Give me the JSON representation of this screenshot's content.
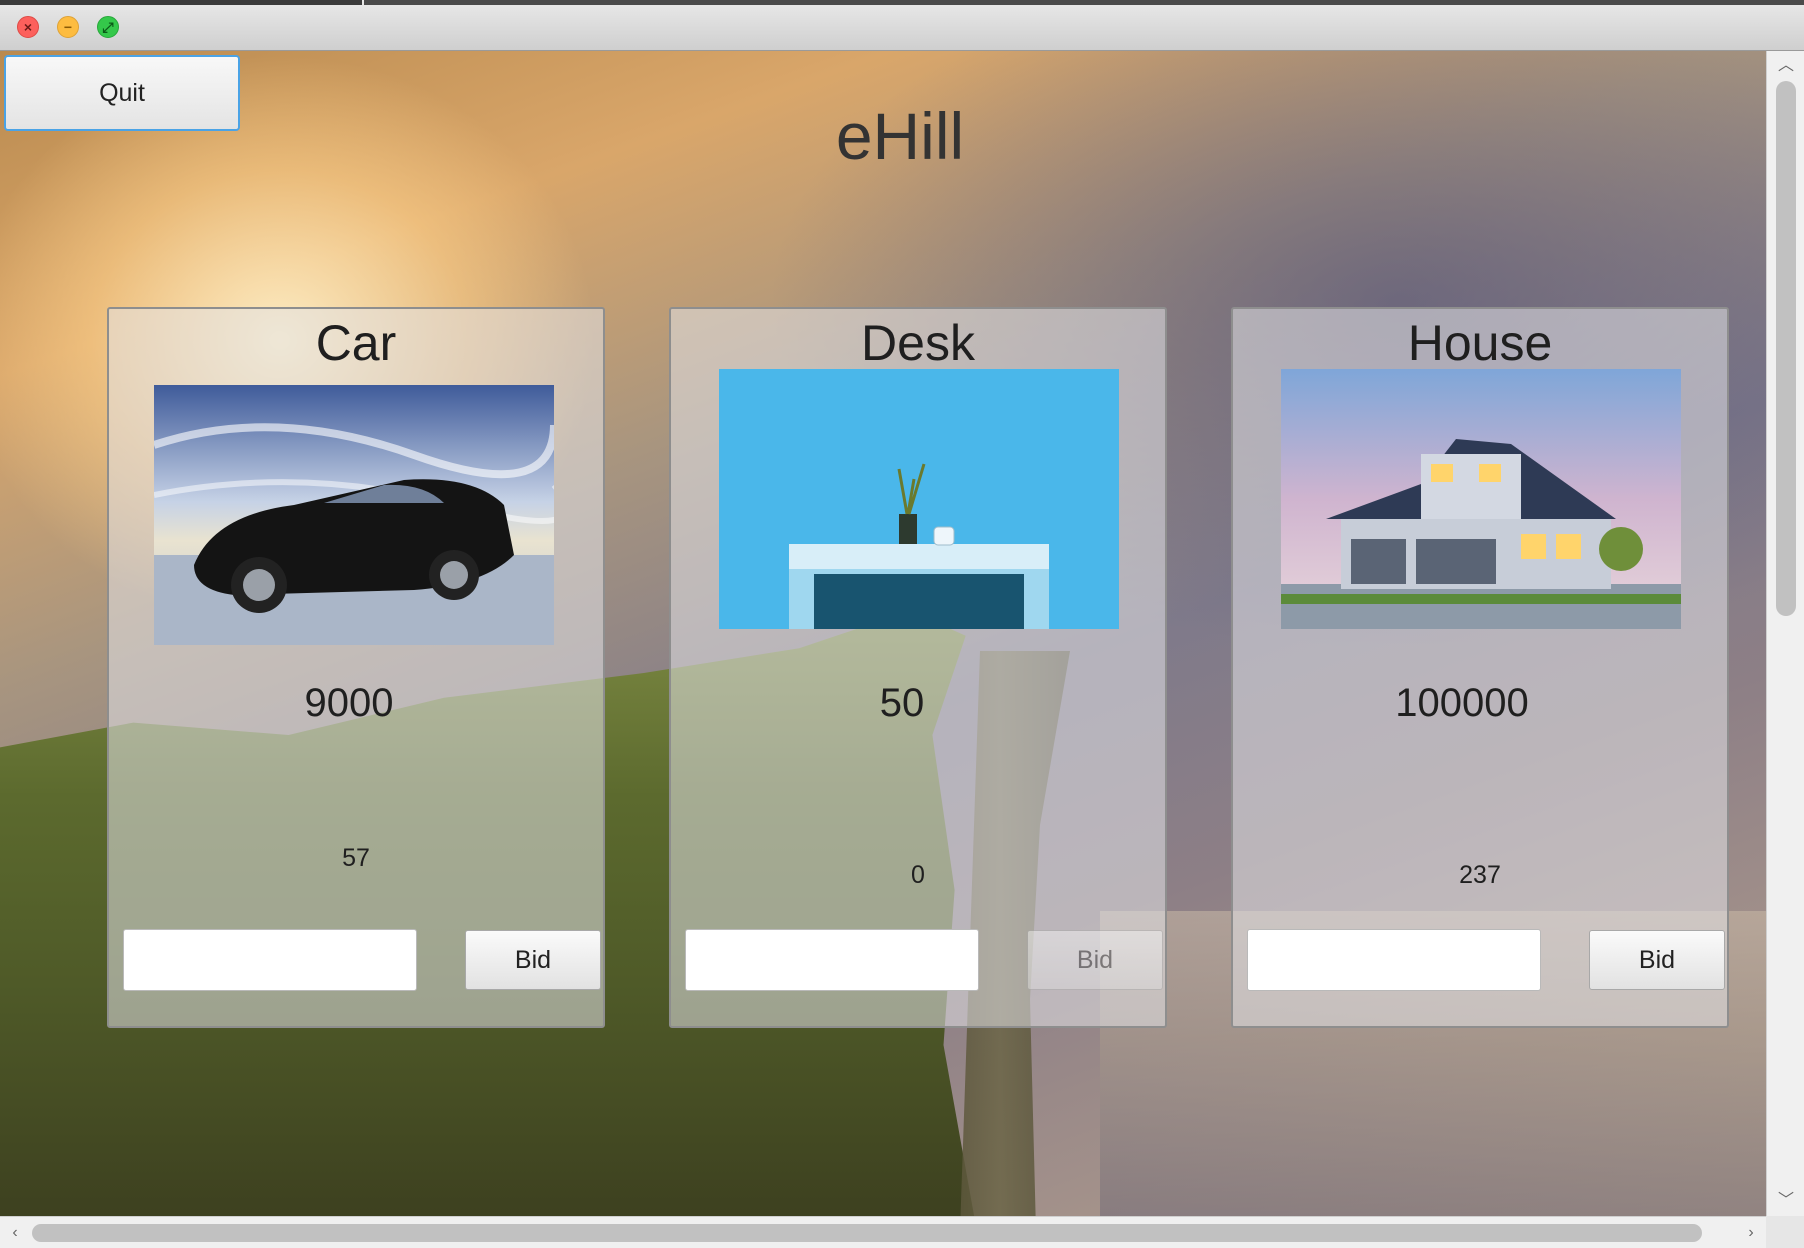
{
  "window": {
    "close_glyph": "×",
    "minimize_glyph": "−",
    "maximize_glyph": "⤢"
  },
  "toolbar": {
    "quit_label": "Quit"
  },
  "app": {
    "title": "eHill"
  },
  "items": [
    {
      "name": "Car",
      "price": "9000",
      "count": "57",
      "bid_label": "Bid",
      "bid_value": "",
      "image_icon": "car-photo"
    },
    {
      "name": "Desk",
      "price": "50",
      "count": "0",
      "bid_label": "Bid",
      "bid_value": "",
      "image_icon": "desk-photo",
      "bid_enabled": false
    },
    {
      "name": "House",
      "price": "100000",
      "count": "237",
      "bid_label": "Bid",
      "bid_value": "",
      "image_icon": "house-photo"
    }
  ],
  "scrollbars": {
    "up_glyph": "︿",
    "down_glyph": "﹀",
    "left_glyph": "‹",
    "right_glyph": "›"
  }
}
